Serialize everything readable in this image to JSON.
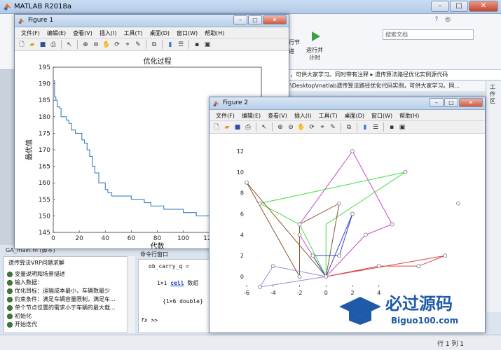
{
  "app": {
    "title": "MATLAB R2018a",
    "search_placeholder": "搜索文档",
    "ribbon_labels": [
      "行节",
      "运行并",
      "计时",
      "进"
    ],
    "path_current": "，可供大家学习。同时带有注释 ▸ 遗传算法路径优化实例源代码",
    "path_full": "\\Desktop\\matlab遗传算法路径优化代码实例，可供大家学习。同...",
    "right_sidebar_label": "工作区",
    "left_tab_label": "当"
  },
  "details_panel": {
    "header": "GA_main.m  (脚本)",
    "title": "遗传算法VRP问题求解",
    "items": [
      "变量说明和场景描述",
      "输入数据：",
      "优化目标：运输成本最小，车辆数最少",
      "约束条件：满足车辆容量限制，满足车...",
      "单个节点位置的需求小于车辆的最大载...",
      "初始化",
      "开始迭代"
    ]
  },
  "command_window": {
    "header": "命令行窗口",
    "line1": "ob_carry_q =",
    "line2_prefix": "1×1 ",
    "line2_kw": "cell",
    "line2_suffix": " 数组",
    "line3": "{1×6 double}",
    "prompt": "fx >>"
  },
  "status_bar": {
    "position": "行 1    列 1"
  },
  "figure1": {
    "title": "Figure 1",
    "menu": [
      "文件(F)",
      "编辑(E)",
      "查看(V)",
      "插入(I)",
      "工具(T)",
      "桌面(D)",
      "窗口(W)",
      "帮助(H)"
    ],
    "chart_data": {
      "type": "line",
      "title": "优化过程",
      "xlabel": "代数",
      "ylabel": "最优值",
      "xlim": [
        0,
        160
      ],
      "ylim": [
        145,
        195
      ],
      "xticks": [
        0,
        20,
        40,
        60,
        80,
        100,
        120,
        140
      ],
      "yticks": [
        145,
        150,
        155,
        160,
        165,
        170,
        175,
        180,
        185,
        190,
        195
      ],
      "color": "#3a7fc1",
      "x": [
        0,
        1,
        2,
        3,
        5,
        6,
        8,
        10,
        12,
        14,
        17,
        20,
        22,
        24,
        26,
        28,
        30,
        32,
        35,
        38,
        40,
        42,
        45,
        50,
        55,
        60,
        65,
        70,
        75,
        80,
        85,
        90,
        95,
        100,
        105,
        110,
        115,
        120,
        125,
        130,
        140,
        150,
        160
      ],
      "y": [
        191,
        186,
        185,
        183,
        182.5,
        180,
        180,
        179,
        178,
        176,
        175,
        175,
        173,
        172,
        170,
        168,
        165,
        163,
        160,
        160,
        158,
        157,
        156,
        156,
        156,
        155,
        155,
        154,
        153,
        153,
        152,
        152,
        152,
        151,
        151,
        150,
        150,
        149,
        149,
        149,
        149,
        148.5,
        148.5
      ]
    }
  },
  "figure2": {
    "title": "Figure 2",
    "menu": [
      "文件(F)",
      "编辑(E)",
      "查看(V)",
      "插入(I)",
      "工具(T)",
      "桌面(D)",
      "窗口(W)",
      "帮助(H)"
    ],
    "chart_data": {
      "type": "line",
      "xlim": [
        -6,
        10
      ],
      "ylim": [
        -1,
        12
      ],
      "xticks": [
        -6,
        -4,
        -2,
        0,
        2,
        4
      ],
      "yticks": [
        0,
        2,
        4,
        6,
        8,
        10,
        12
      ],
      "series": [
        {
          "color": "#cc44cc",
          "x": [
            0,
            3,
            5,
            2,
            -2,
            -2,
            0
          ],
          "y": [
            0,
            4,
            5,
            12,
            5,
            4,
            0
          ]
        },
        {
          "color": "#44dd44",
          "x": [
            0,
            -2,
            -5,
            6,
            0,
            0
          ],
          "y": [
            0,
            5,
            7,
            10,
            5,
            0
          ]
        },
        {
          "color": "#885533",
          "x": [
            0,
            -6,
            -2,
            -2,
            1,
            0
          ],
          "y": [
            0,
            9,
            0,
            5,
            7,
            0
          ]
        },
        {
          "color": "#3344cc",
          "x": [
            0,
            -1,
            1,
            2,
            0
          ],
          "y": [
            0,
            2,
            2,
            6,
            0
          ]
        },
        {
          "color": "#9988dd",
          "x": [
            0,
            -4,
            -5,
            0
          ],
          "y": [
            0,
            1,
            -1,
            0
          ]
        },
        {
          "color": "#dd4444",
          "x": [
            0,
            4,
            7,
            9,
            0
          ],
          "y": [
            0,
            1,
            1,
            2,
            0
          ]
        }
      ],
      "points": [
        [
          0,
          0
        ],
        [
          1,
          7
        ],
        [
          3,
          4
        ],
        [
          2,
          12
        ],
        [
          5,
          5
        ],
        [
          -2,
          4
        ],
        [
          -2,
          5
        ],
        [
          -1,
          2
        ],
        [
          1,
          2
        ],
        [
          2,
          6
        ],
        [
          -6,
          9
        ],
        [
          -5,
          7
        ],
        [
          6,
          10
        ],
        [
          -4,
          1
        ],
        [
          -5,
          -1
        ],
        [
          4,
          1
        ],
        [
          7,
          1
        ],
        [
          9,
          2
        ],
        [
          -2,
          0
        ],
        [
          10,
          7
        ]
      ]
    }
  },
  "watermark": {
    "title": "必过源码",
    "url": "Biguo100.com"
  }
}
